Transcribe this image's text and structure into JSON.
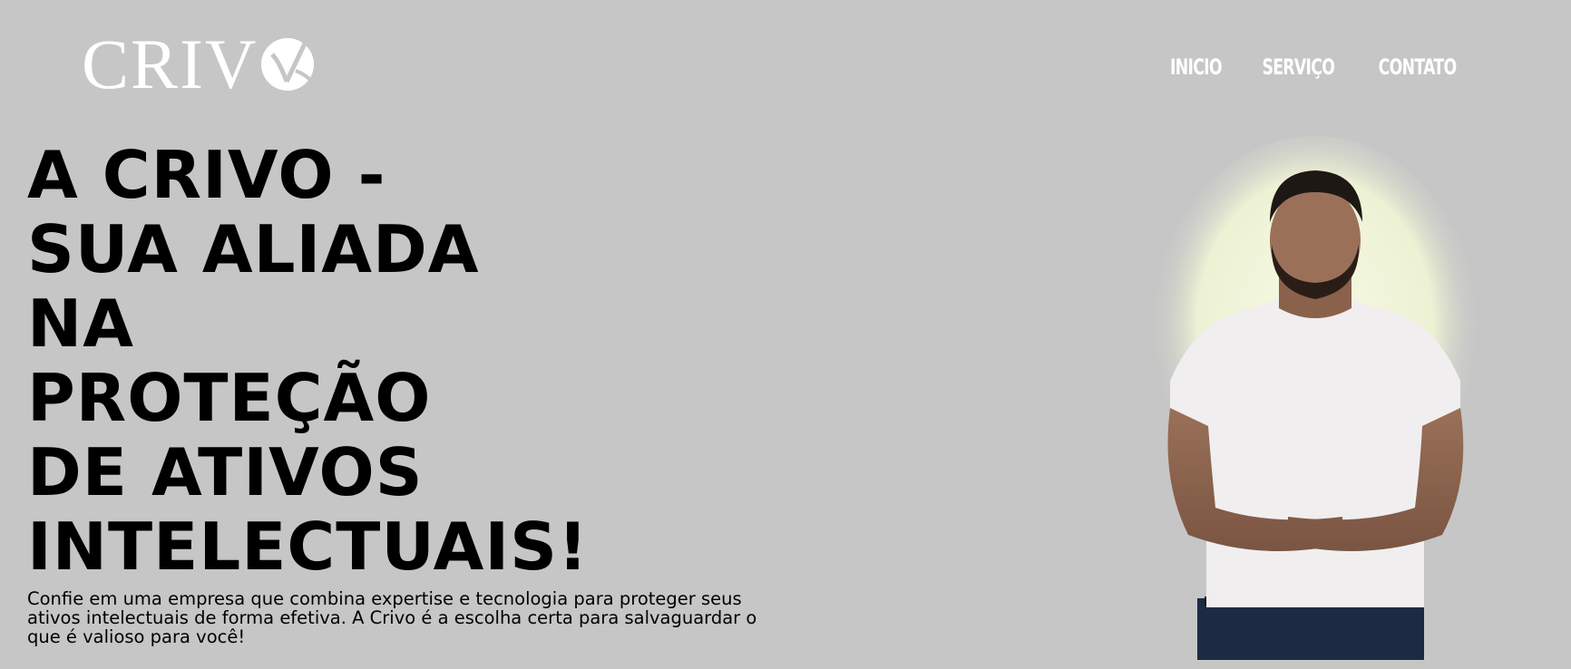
{
  "brand": {
    "name": "CRIV"
  },
  "nav": {
    "items": [
      "INICIO",
      "SERVIÇO",
      "CONTATO"
    ]
  },
  "hero": {
    "title_lines": [
      "A CRIVO -",
      "SUA ALIADA",
      "NA",
      "PROTEÇÃO",
      "DE ATIVOS",
      "INTELECTUAIS!"
    ],
    "description": "Confie em uma empresa que combina expertise e tecnologia para proteger seus ativos intelectuais de forma efetiva. A Crivo é a escolha certa para salvaguardar o que é valioso para você!"
  },
  "colors": {
    "background": "#c6c6c6",
    "text": "#000000",
    "nav_text": "#ffffff",
    "glow": "#f4f7e0"
  },
  "icons": {
    "logo_mark": "crivo-logo-mark-icon"
  }
}
